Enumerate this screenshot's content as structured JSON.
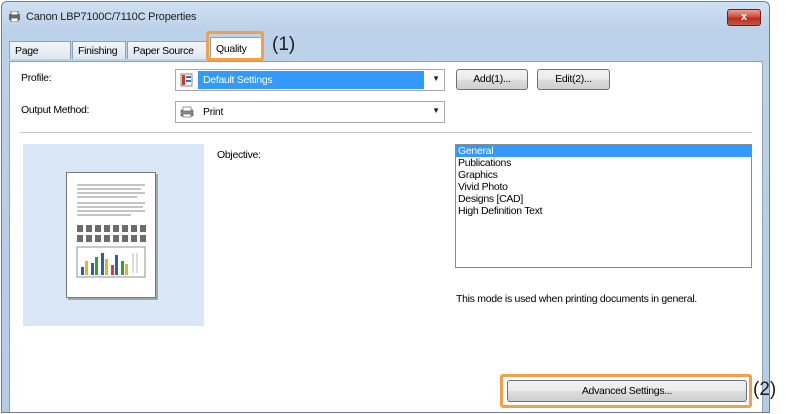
{
  "window": {
    "title": "Canon LBP7100C/7110C Properties",
    "close_label": "x"
  },
  "tabs": [
    {
      "label": "Page Setup"
    },
    {
      "label": "Finishing"
    },
    {
      "label": "Paper Source"
    },
    {
      "label": "Quality",
      "active": true
    }
  ],
  "callouts": {
    "one": "(1)",
    "two": "(2)"
  },
  "profile": {
    "label": "Profile:",
    "value": "Default Settings",
    "add_button": "Add(1)...",
    "edit_button": "Edit(2)..."
  },
  "output_method": {
    "label": "Output Method:",
    "value": "Print"
  },
  "objective": {
    "label": "Objective:",
    "options": [
      "General",
      "Publications",
      "Graphics",
      "Vivid Photo",
      "Designs [CAD]",
      "High Definition Text"
    ],
    "selected": "General",
    "description": "This mode is used when printing documents in general."
  },
  "advanced_button": "Advanced Settings...",
  "colors": {
    "highlight": "#f0a14a",
    "selection": "#3399ff"
  }
}
